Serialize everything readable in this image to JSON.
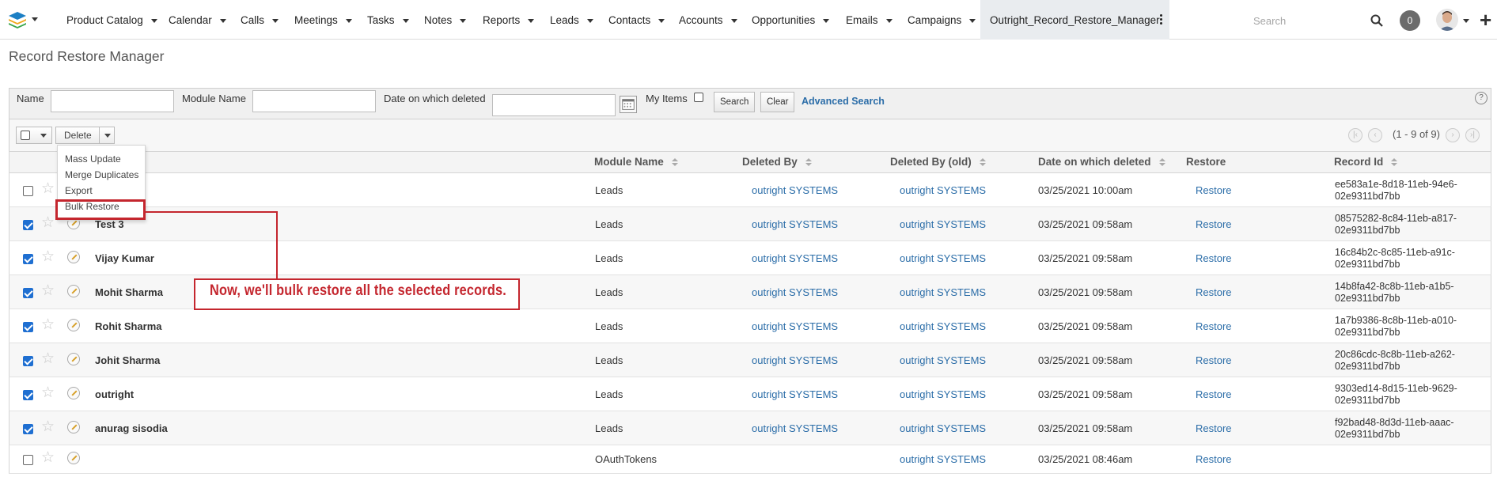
{
  "nav": {
    "items": [
      {
        "label": "Product Catalog"
      },
      {
        "label": "Calendar"
      },
      {
        "label": "Calls"
      },
      {
        "label": "Meetings"
      },
      {
        "label": "Tasks"
      },
      {
        "label": "Notes"
      },
      {
        "label": "Reports"
      },
      {
        "label": "Leads"
      },
      {
        "label": "Contacts"
      },
      {
        "label": "Accounts"
      },
      {
        "label": "Opportunities"
      },
      {
        "label": "Emails"
      },
      {
        "label": "Campaigns"
      }
    ],
    "active_tab": "Outright_Record_Restore_Manager",
    "search_placeholder": "Search",
    "notification_count": "0",
    "more_icon": "more-vertical-icon",
    "plus_icon": "plus-icon"
  },
  "page": {
    "title": "Record Restore Manager"
  },
  "search_form": {
    "name_label": "Name",
    "name_value": "",
    "module_label": "Module Name",
    "module_value": "",
    "date_label": "Date on which deleted",
    "date_value": "",
    "my_items_label": "My Items",
    "search_button": "Search",
    "clear_button": "Clear",
    "advanced_link": "Advanced Search",
    "help": "?"
  },
  "toolbar": {
    "delete_label": "Delete",
    "pagination": "(1 - 9 of 9)"
  },
  "bulk_menu": {
    "items": [
      "Mass Update",
      "Merge Duplicates",
      "Export",
      "Bulk Restore"
    ]
  },
  "table": {
    "headers": {
      "module": "Module Name",
      "deleted_by": "Deleted By",
      "deleted_by_old": "Deleted By (old)",
      "date": "Date on which deleted",
      "restore": "Restore",
      "record_id": "Record Id"
    },
    "rows": [
      {
        "checked": false,
        "name": "",
        "module": "Leads",
        "deleted_by": "outright SYSTEMS",
        "deleted_by_old": "outright SYSTEMS",
        "date": "03/25/2021 10:00am",
        "restore": "Restore",
        "record_id_1": "ee583a1e-8d18-11eb-94e6-",
        "record_id_2": "02e9311bd7bb"
      },
      {
        "checked": true,
        "name": "Test 3",
        "module": "Leads",
        "deleted_by": "outright SYSTEMS",
        "deleted_by_old": "outright SYSTEMS",
        "date": "03/25/2021 09:58am",
        "restore": "Restore",
        "record_id_1": "08575282-8c84-11eb-a817-",
        "record_id_2": "02e9311bd7bb"
      },
      {
        "checked": true,
        "name": "Vijay Kumar",
        "module": "Leads",
        "deleted_by": "outright SYSTEMS",
        "deleted_by_old": "outright SYSTEMS",
        "date": "03/25/2021 09:58am",
        "restore": "Restore",
        "record_id_1": "16c84b2c-8c85-11eb-a91c-",
        "record_id_2": "02e9311bd7bb"
      },
      {
        "checked": true,
        "name": "Mohit Sharma",
        "module": "Leads",
        "deleted_by": "outright SYSTEMS",
        "deleted_by_old": "outright SYSTEMS",
        "date": "03/25/2021 09:58am",
        "restore": "Restore",
        "record_id_1": "14b8fa42-8c8b-11eb-a1b5-",
        "record_id_2": "02e9311bd7bb"
      },
      {
        "checked": true,
        "name": "Rohit Sharma",
        "module": "Leads",
        "deleted_by": "outright SYSTEMS",
        "deleted_by_old": "outright SYSTEMS",
        "date": "03/25/2021 09:58am",
        "restore": "Restore",
        "record_id_1": "1a7b9386-8c8b-11eb-a010-",
        "record_id_2": "02e9311bd7bb"
      },
      {
        "checked": true,
        "name": "Johit Sharma",
        "module": "Leads",
        "deleted_by": "outright SYSTEMS",
        "deleted_by_old": "outright SYSTEMS",
        "date": "03/25/2021 09:58am",
        "restore": "Restore",
        "record_id_1": "20c86cdc-8c8b-11eb-a262-",
        "record_id_2": "02e9311bd7bb"
      },
      {
        "checked": true,
        "name": "outright",
        "module": "Leads",
        "deleted_by": "outright SYSTEMS",
        "deleted_by_old": "outright SYSTEMS",
        "date": "03/25/2021 09:58am",
        "restore": "Restore",
        "record_id_1": "9303ed14-8d15-11eb-9629-",
        "record_id_2": "02e9311bd7bb"
      },
      {
        "checked": true,
        "name": "anurag sisodia",
        "module": "Leads",
        "deleted_by": "outright SYSTEMS",
        "deleted_by_old": "outright SYSTEMS",
        "date": "03/25/2021 09:58am",
        "restore": "Restore",
        "record_id_1": "f92bad48-8d3d-11eb-aaac-",
        "record_id_2": "02e9311bd7bb"
      },
      {
        "checked": false,
        "name": "",
        "module": "OAuthTokens",
        "deleted_by": "",
        "deleted_by_old": "outright SYSTEMS",
        "date": "03/25/2021 08:46am",
        "restore": "Restore",
        "record_id_1": "",
        "record_id_2": ""
      }
    ]
  },
  "annotation": {
    "text": "Now, we'll bulk restore all the selected records.",
    "color": "#c4262e"
  }
}
